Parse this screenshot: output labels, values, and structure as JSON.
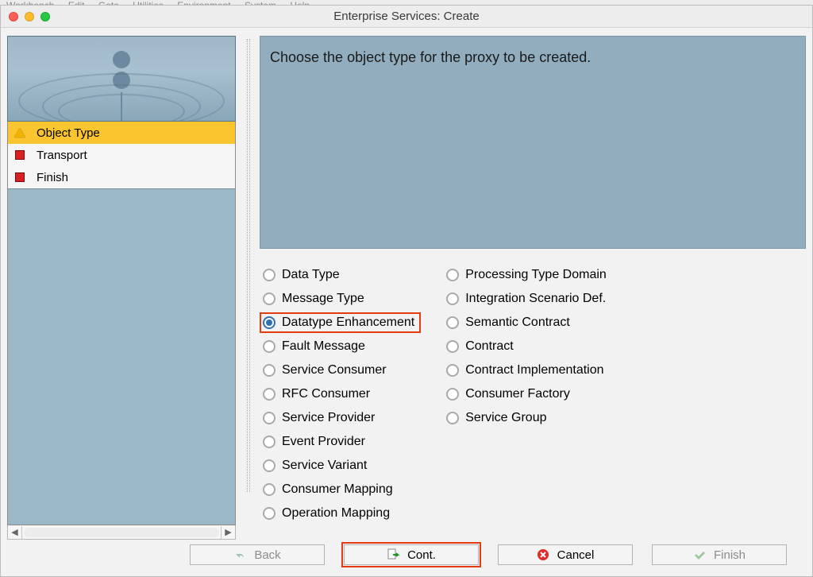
{
  "menubar": {
    "items": [
      "Workbench",
      "Edit",
      "Goto",
      "Utilities",
      "Environment",
      "System",
      "Help"
    ]
  },
  "window": {
    "title": "Enterprise Services: Create"
  },
  "steps": [
    {
      "label": "Object Type",
      "icon": "warn",
      "active": true
    },
    {
      "label": "Transport",
      "icon": "stop",
      "active": false
    },
    {
      "label": "Finish",
      "icon": "stop",
      "active": false
    }
  ],
  "prompt": "Choose the object type for the proxy to be created.",
  "options_left": [
    {
      "label": "Data Type",
      "checked": false,
      "highlighted": false
    },
    {
      "label": "Message Type",
      "checked": false,
      "highlighted": false
    },
    {
      "label": "Datatype Enhancement",
      "checked": true,
      "highlighted": true
    },
    {
      "label": "Fault Message",
      "checked": false,
      "highlighted": false
    },
    {
      "label": "Service Consumer",
      "checked": false,
      "highlighted": false
    },
    {
      "label": "RFC Consumer",
      "checked": false,
      "highlighted": false
    },
    {
      "label": "Service Provider",
      "checked": false,
      "highlighted": false
    },
    {
      "label": "Event Provider",
      "checked": false,
      "highlighted": false
    },
    {
      "label": "Service Variant",
      "checked": false,
      "highlighted": false
    },
    {
      "label": "Consumer Mapping",
      "checked": false,
      "highlighted": false
    },
    {
      "label": "Operation Mapping",
      "checked": false,
      "highlighted": false
    }
  ],
  "options_right": [
    {
      "label": "Processing Type Domain",
      "checked": false
    },
    {
      "label": "Integration Scenario Def.",
      "checked": false
    },
    {
      "label": "Semantic Contract",
      "checked": false
    },
    {
      "label": "Contract",
      "checked": false
    },
    {
      "label": "Contract Implementation",
      "checked": false
    },
    {
      "label": "Consumer Factory",
      "checked": false
    },
    {
      "label": "Service Group",
      "checked": false
    }
  ],
  "buttons": {
    "back": "Back",
    "cont": "Cont.",
    "cancel": "Cancel",
    "finish": "Finish"
  }
}
